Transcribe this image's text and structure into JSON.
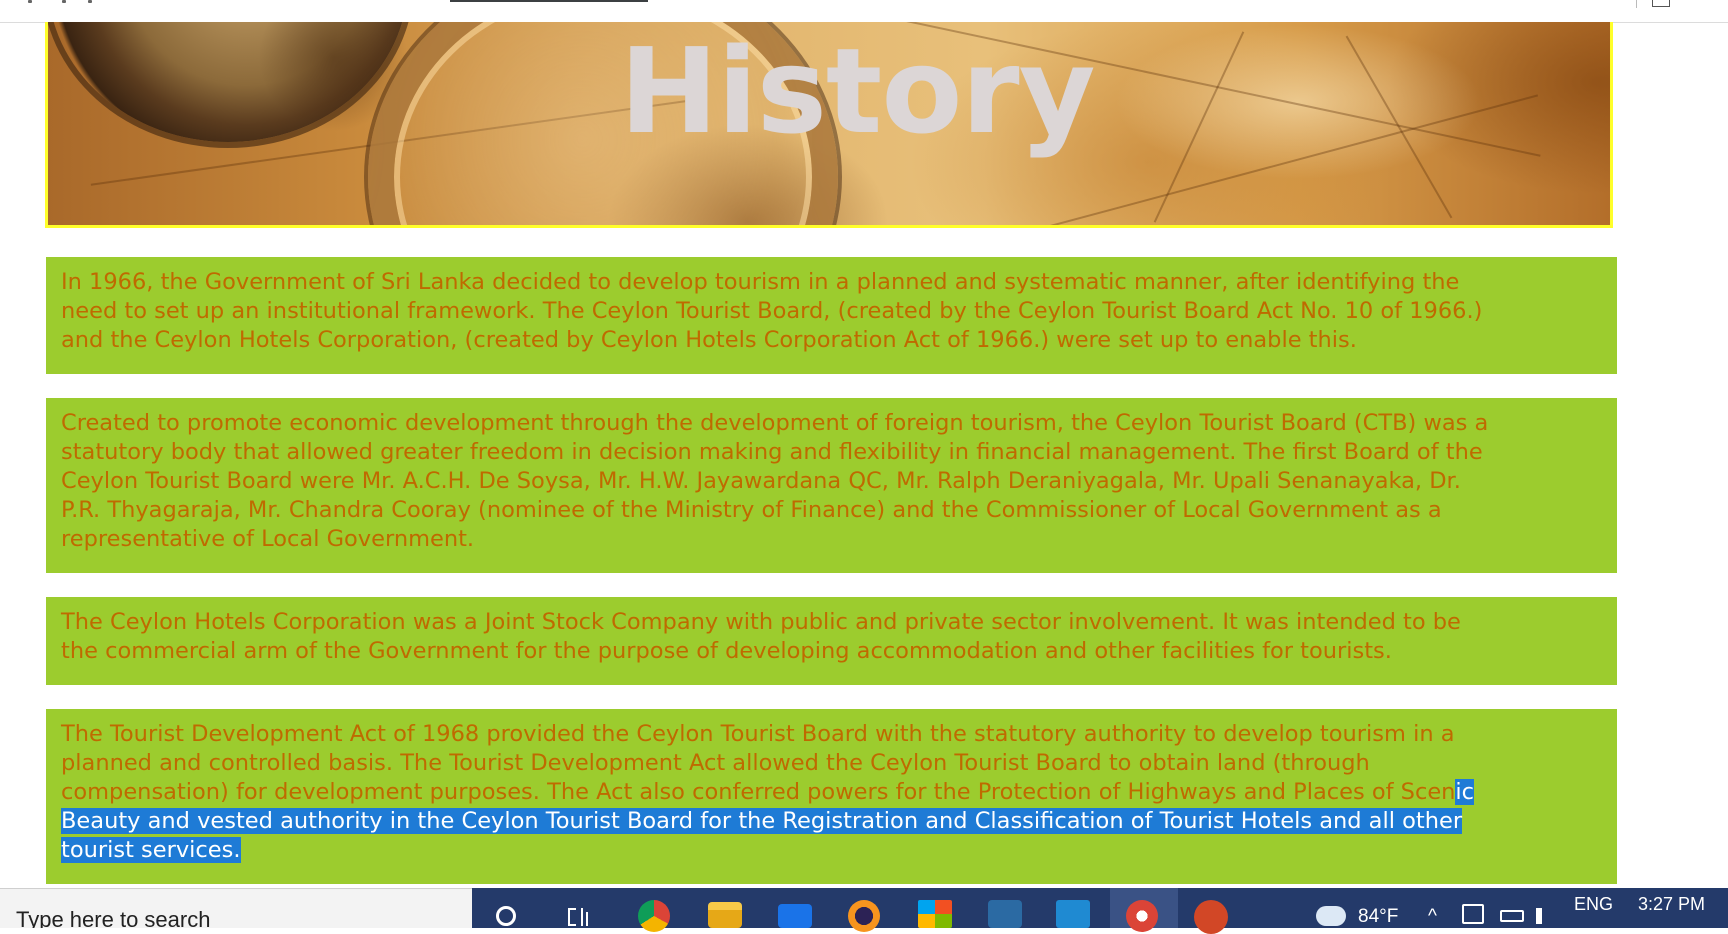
{
  "banner": {
    "title": "History"
  },
  "paragraphs": [
    {
      "lines": [
        "In 1966, the Government of Sri Lanka decided to develop tourism in a planned and systematic manner, after identifying the",
        "need to set up an institutional framework. The Ceylon Tourist Board, (created by the Ceylon Tourist Board Act No. 10 of 1966.)",
        "and the Ceylon Hotels Corporation, (created by Ceylon Hotels Corporation Act of 1966.) were set up to enable this."
      ]
    },
    {
      "lines": [
        "Created to promote economic development through the development of foreign tourism, the Ceylon Tourist Board (CTB) was a",
        "statutory body that allowed greater freedom in decision making and flexibility in financial management. The first Board of the",
        "Ceylon Tourist Board were Mr. A.C.H. De Soysa, Mr. H.W. Jayawardana QC, Mr. Ralph Deraniyagala, Mr. Upali Senanayaka, Dr.",
        "P.R. Thyagaraja, Mr. Chandra Cooray (nominee of the Ministry of Finance) and the Commissioner of Local Government as a",
        "representative of Local Government."
      ]
    },
    {
      "lines": [
        "The Ceylon Hotels Corporation was a Joint Stock Company with public and private sector involvement. It was intended to be",
        "the commercial arm of the Government for the purpose of developing accommodation and other facilities for tourists."
      ]
    },
    {
      "lines": [
        "The Tourist Development Act of 1968 provided the Ceylon Tourist Board with the statutory authority to develop tourism in a",
        "planned and controlled basis. The Tourist Development Act allowed the Ceylon Tourist Board to obtain land (through"
      ],
      "line3_plain": "compensation) for development purposes. The Act also conferred powers for the Protection of Highways and Places of Scen",
      "line3_selected": "ic",
      "line4_selected": "Beauty and vested authority in the Ceylon Tourist Board for the Registration and Classification of Tourist Hotels and all other",
      "line5_selected": "tourist services."
    }
  ],
  "taskbar": {
    "search_placeholder": "Type here to search",
    "weather": "84°F",
    "language": "ENG",
    "time": "3:27 PM"
  },
  "colors": {
    "paragraph_background": "#9ccc2e",
    "paragraph_text": "#bf6a00",
    "banner_border": "#ffff2a",
    "selection": "#1e7bd6",
    "taskbar": "#243a6a"
  }
}
